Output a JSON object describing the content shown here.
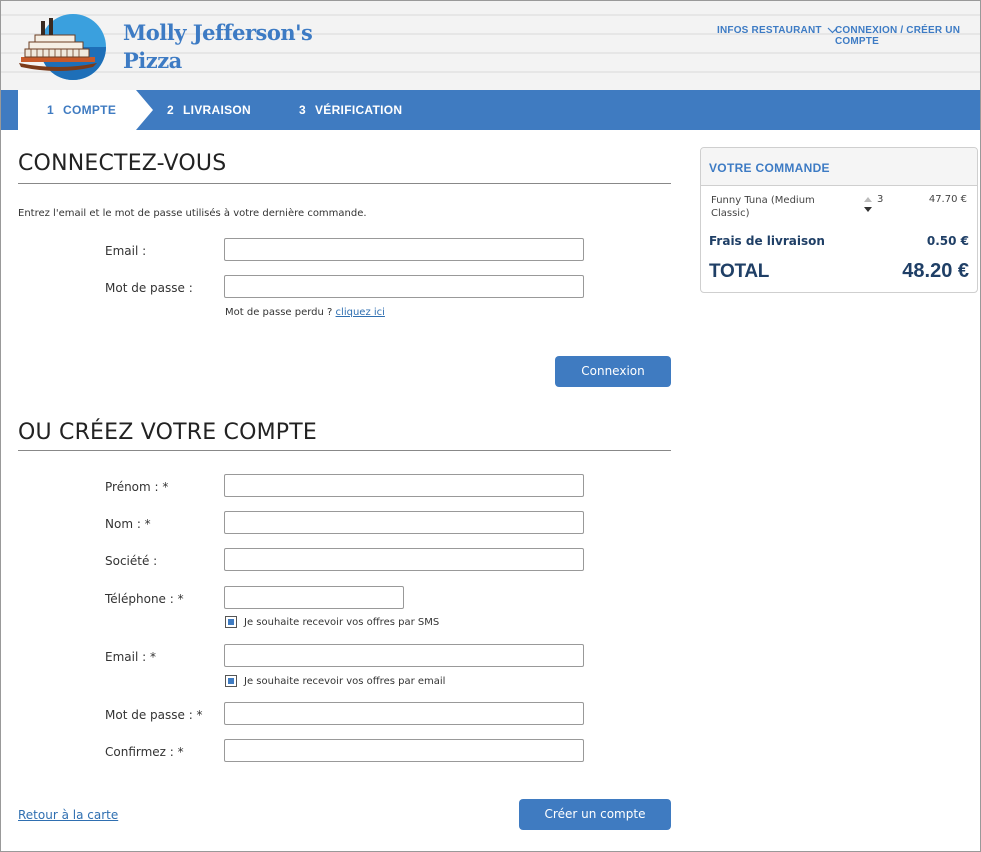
{
  "header": {
    "brand_line1": "Molly Jefferson's",
    "brand_line2": "Pizza",
    "nav_infos": "INFOS RESTAURANT",
    "nav_login": "CONNEXION / CRÉER UN COMPTE"
  },
  "steps": [
    {
      "num": "1",
      "label": "COMPTE",
      "active": true
    },
    {
      "num": "2",
      "label": "LIVRAISON",
      "active": false
    },
    {
      "num": "3",
      "label": "VÉRIFICATION",
      "active": false
    }
  ],
  "login": {
    "heading": "CONNECTEZ-VOUS",
    "intro": "Entrez l'email et le mot de passe utilisés à votre dernière commande.",
    "email_label": "Email :",
    "email_value": "",
    "password_label": "Mot de passe :",
    "password_value": "",
    "lost_password_text": "Mot de passe perdu ? ",
    "lost_password_link": "cliquez ici",
    "submit_label": "Connexion"
  },
  "register": {
    "heading": "OU CRÉEZ VOTRE COMPTE",
    "firstname_label": "Prénom : *",
    "lastname_label": "Nom : *",
    "company_label": "Société :",
    "phone_label": "Téléphone : *",
    "sms_optin_label": "Je souhaite recevoir vos offres par SMS",
    "sms_optin_checked": true,
    "email_label": "Email : *",
    "email_optin_label": "Je souhaite recevoir vos offres par email",
    "email_optin_checked": true,
    "password_label": "Mot de passe : *",
    "confirm_label": "Confirmez : *",
    "back_link": "Retour à la carte",
    "submit_label": "Créer un compte"
  },
  "order": {
    "heading": "VOTRE COMMANDE",
    "items": [
      {
        "name": "Funny Tuna (Medium Classic)",
        "qty": "3",
        "price": "47.70 €"
      }
    ],
    "delivery_label": "Frais de livraison",
    "delivery_value": "0.50 €",
    "total_label": "TOTAL",
    "total_value": "48.20 €"
  },
  "colors": {
    "accent": "#3f7bc1",
    "dark_text": "#1f3f66"
  }
}
